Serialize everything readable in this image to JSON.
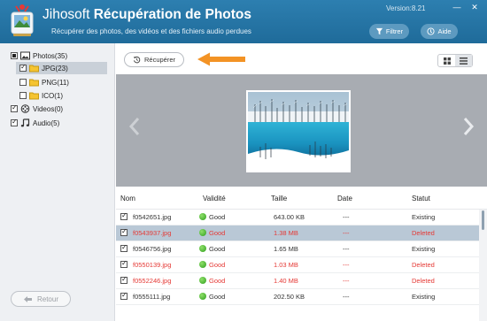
{
  "header": {
    "brand": "Jihosoft",
    "app": "Récupération de Photos",
    "subtitle": "Récupérer des photos, des vidéos et des fichiers audio perdues",
    "version": "Version:8.21",
    "filter_label": "Filtrer",
    "help_label": "Aide",
    "accent": "#2570a3"
  },
  "sidebar": {
    "items": [
      {
        "label": "Photos(35)",
        "icon": "photo-icon",
        "state": "partial"
      },
      {
        "label": "JPG(23)",
        "icon": "folder-icon",
        "state": "checked",
        "selected": true
      },
      {
        "label": "PNG(11)",
        "icon": "folder-icon",
        "state": "unchecked"
      },
      {
        "label": "ICO(1)",
        "icon": "folder-icon",
        "state": "unchecked"
      },
      {
        "label": "Videos(0)",
        "icon": "film-icon",
        "state": "checked"
      },
      {
        "label": "Audio(5)",
        "icon": "music-note-icon",
        "state": "checked"
      }
    ],
    "back_label": "Retour"
  },
  "toolbar": {
    "recover_label": "Récupérer"
  },
  "table": {
    "columns": [
      "Nom",
      "Validité",
      "Taille",
      "Date",
      "Statut"
    ],
    "rows": [
      {
        "name": "f0542651.jpg",
        "validity": "Good",
        "size": "643.00 KB",
        "date": "---",
        "status": "Existing",
        "deleted": false,
        "selected": false
      },
      {
        "name": "f0543937.jpg",
        "validity": "Good",
        "size": "1.38 MB",
        "date": "---",
        "status": "Deleted",
        "deleted": true,
        "selected": true
      },
      {
        "name": "f0546756.jpg",
        "validity": "Good",
        "size": "1.65 MB",
        "date": "---",
        "status": "Existing",
        "deleted": false,
        "selected": false
      },
      {
        "name": "f0550139.jpg",
        "validity": "Good",
        "size": "1.03 MB",
        "date": "---",
        "status": "Deleted",
        "deleted": true,
        "selected": false
      },
      {
        "name": "f0552246.jpg",
        "validity": "Good",
        "size": "1.40 MB",
        "date": "---",
        "status": "Deleted",
        "deleted": true,
        "selected": false
      },
      {
        "name": "f0555111.jpg",
        "validity": "Good",
        "size": "202.50 KB",
        "date": "---",
        "status": "Existing",
        "deleted": false,
        "selected": false
      }
    ]
  }
}
